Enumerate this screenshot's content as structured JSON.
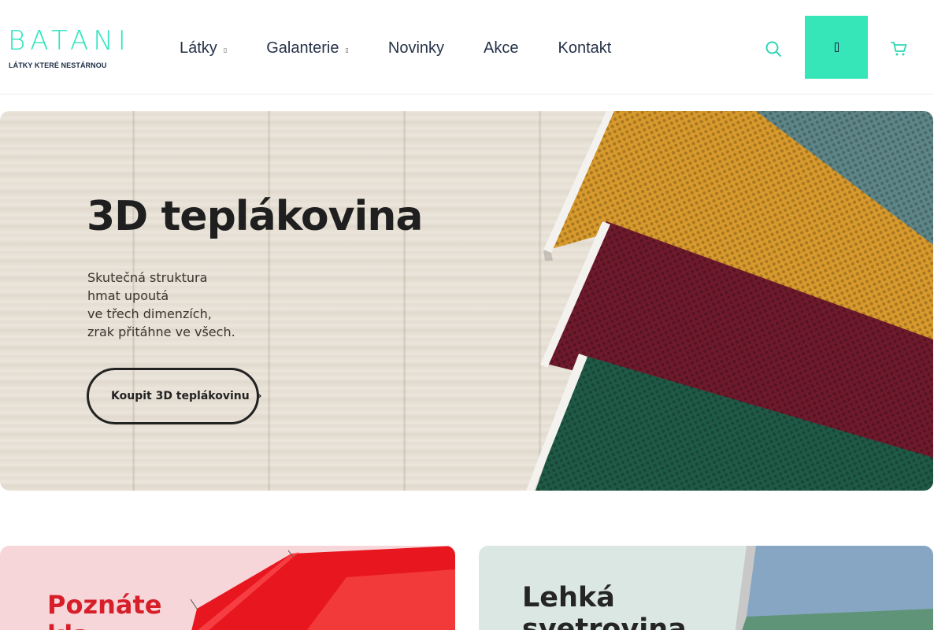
{
  "header": {
    "logo": {
      "word": "BATANI",
      "tagline": "LÁTKY KTERÉ NESTÁRNOU"
    },
    "nav": [
      {
        "label": "Látky",
        "has_dropdown": true
      },
      {
        "label": "Galanterie",
        "has_dropdown": true
      },
      {
        "label": "Novinky",
        "has_dropdown": false
      },
      {
        "label": "Akce",
        "has_dropdown": false
      },
      {
        "label": "Kontakt",
        "has_dropdown": false
      }
    ],
    "icons": {
      "search": "search-icon",
      "account": "account-icon",
      "cart": "cart-icon",
      "caret": "chevron-down-icon"
    }
  },
  "hero": {
    "title": "3D teplákovina",
    "subtitle_lines": [
      "Skutečná struktura",
      "hmat upoutá",
      "ve třech dimenzích,",
      "zrak přitáhne ve všech."
    ],
    "cta_label": "Koupit 3D teplákovinu",
    "cta_icon": "chevron-right-icon",
    "fabric_colors": [
      "#d89a2c",
      "#6e1a2c",
      "#1f5a46",
      "#5e8688"
    ]
  },
  "promo_cards": [
    {
      "title_lines": [
        "Poznáte",
        "kla"
      ],
      "background": "#f7d6da",
      "accent": "#e8161f"
    },
    {
      "title_lines": [
        "Lehká",
        "svetrovina"
      ],
      "background": "#dbe7e3",
      "accent": "#86a6c3"
    }
  ],
  "colors": {
    "brand": "#2ee6bf",
    "account_button": "#36e6b9",
    "navy": "#1b2c44"
  }
}
